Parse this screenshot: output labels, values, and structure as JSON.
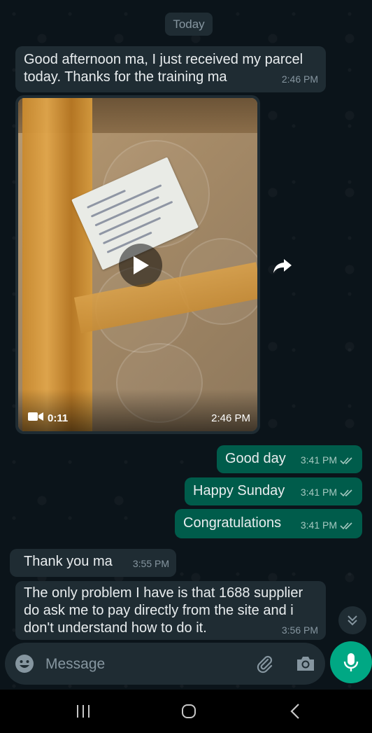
{
  "chat": {
    "day_chip": "Today",
    "messages": {
      "m1": {
        "text": "Good afternoon ma, I just received my parcel today. Thanks for the training ma",
        "time": "2:46 PM"
      },
      "video": {
        "duration": "0:11",
        "time": "2:46 PM"
      },
      "o1": {
        "text": "Good day",
        "time": "3:41 PM"
      },
      "o2": {
        "text": "Happy Sunday",
        "time": "3:41 PM"
      },
      "o3": {
        "text": "Congratulations",
        "time": "3:41 PM"
      },
      "i2": {
        "text": "Thank you ma",
        "time": "3:55 PM"
      },
      "i3": {
        "text": "The only problem I have is that 1688 supplier do ask me to pay directly from the site and i don't understand how to do it.",
        "time": "3:56 PM"
      }
    }
  },
  "composer": {
    "placeholder": "Message"
  },
  "icons": {
    "forward": "forward-icon",
    "scroll": "chevron-double-down-icon",
    "emoji": "emoji-icon",
    "attach": "paperclip-icon",
    "camera": "camera-icon",
    "mic": "microphone-icon",
    "play": "play-icon",
    "video": "video-camera-icon",
    "read": "double-check-icon"
  },
  "colors": {
    "incoming": "#1f2c33",
    "outgoing": "#005c4b",
    "accent": "#00a884",
    "background": "#0b141a"
  }
}
